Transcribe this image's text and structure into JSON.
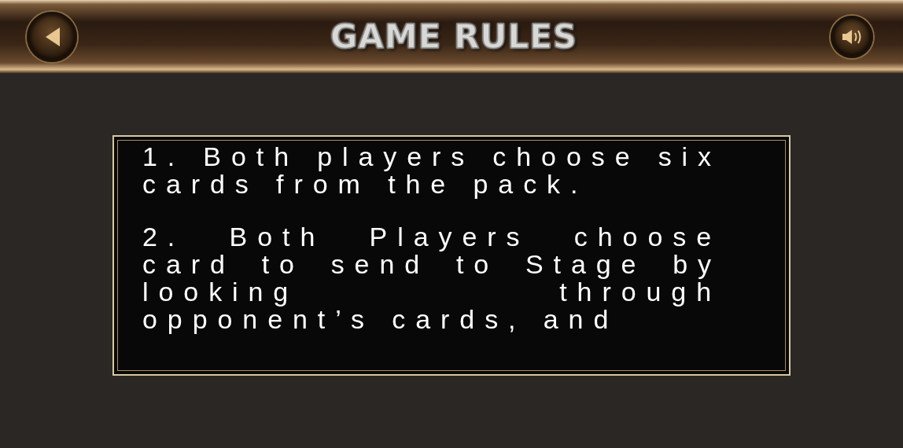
{
  "header": {
    "title": "GAME RULES"
  },
  "rules": [
    "1. Both players choose six cards from the pack.",
    "2. Both Players choose card to send to Stage by looking through opponent’s cards, and"
  ]
}
